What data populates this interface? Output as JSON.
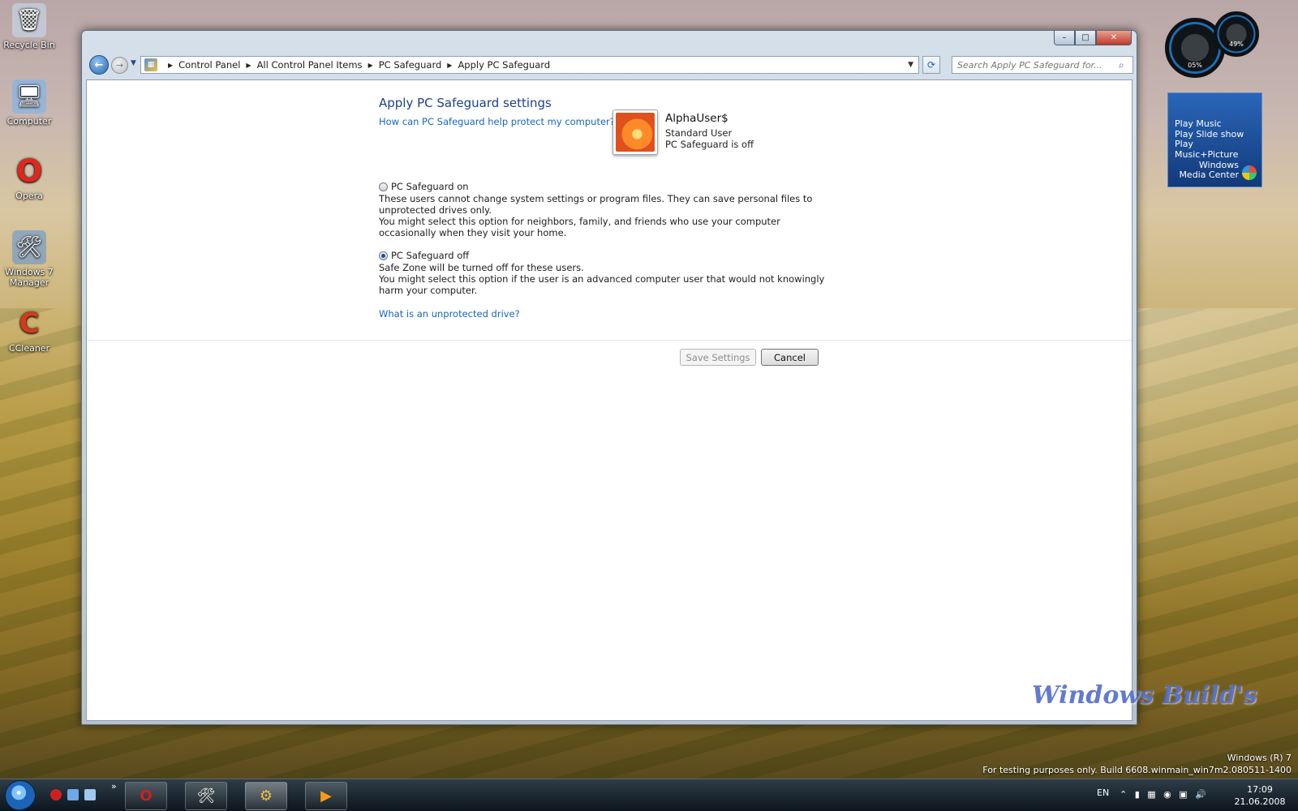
{
  "desktop": {
    "icons": [
      {
        "label": "Recycle Bin",
        "glyph": "🗑"
      },
      {
        "label": "Computer",
        "glyph": "🖥"
      },
      {
        "label": "Opera",
        "glyph": "O"
      },
      {
        "label": "Windows 7 Manager",
        "glyph": "🛠"
      },
      {
        "label": "CCleaner",
        "glyph": "C"
      }
    ]
  },
  "window": {
    "caption": {
      "minimize": "–",
      "maximize": "□",
      "close": "✕"
    },
    "breadcrumbs": [
      "Control Panel",
      "All Control Panel Items",
      "PC Safeguard",
      "Apply PC Safeguard"
    ],
    "search_placeholder": "Search Apply PC Safeguard for...",
    "content": {
      "title": "Apply PC Safeguard settings",
      "help_link": "How can PC Safeguard help protect my computer?",
      "user": {
        "name": "AlphaUser$",
        "type": "Standard User",
        "status": "PC Safeguard is off"
      },
      "options": [
        {
          "label": "PC Safeguard on",
          "checked": false,
          "lines": [
            "These users cannot change system settings or program files. They can save personal files to unprotected drives only.",
            "You might select this option for neighbors, family, and friends who use your computer occasionally when they visit your home."
          ]
        },
        {
          "label": "PC Safeguard off",
          "checked": true,
          "lines": [
            "Safe Zone will be turned off for these users.",
            "You might select this option if the user is an advanced computer user that would not knowingly harm your computer."
          ]
        }
      ],
      "drive_link": "What is an unprotected drive?",
      "buttons": {
        "save": "Save Settings",
        "cancel": "Cancel"
      }
    }
  },
  "gadgets": {
    "meter": {
      "cpu": "05%",
      "memory": "49%"
    },
    "media_center": {
      "items": [
        "Play Music",
        "Play Slide show",
        "Play Music+Picture"
      ],
      "label_line1": "Windows",
      "label_line2": "Media Center"
    }
  },
  "watermark": {
    "logo_text": "Windows Build's",
    "line1": "Windows (R) 7",
    "line2": "For testing purposes only. Build 6608.winmain_win7m2.080511-1400"
  },
  "taskbar": {
    "tasks": [
      {
        "name": "opera",
        "glyph": "O",
        "color": "#d01f1f"
      },
      {
        "name": "windows-7-manager",
        "glyph": "🛠",
        "color": "#ffffff"
      },
      {
        "name": "control-panel",
        "glyph": "⚙",
        "color": "#f0c040"
      },
      {
        "name": "media-player",
        "glyph": "▶",
        "color": "#f39c12"
      }
    ],
    "more": "»",
    "language": "EN",
    "tray_glyphs": "⌃ ▮ ▦ ◉ ▣ 🔊",
    "time": "17:09",
    "date": "21.06.2008"
  }
}
